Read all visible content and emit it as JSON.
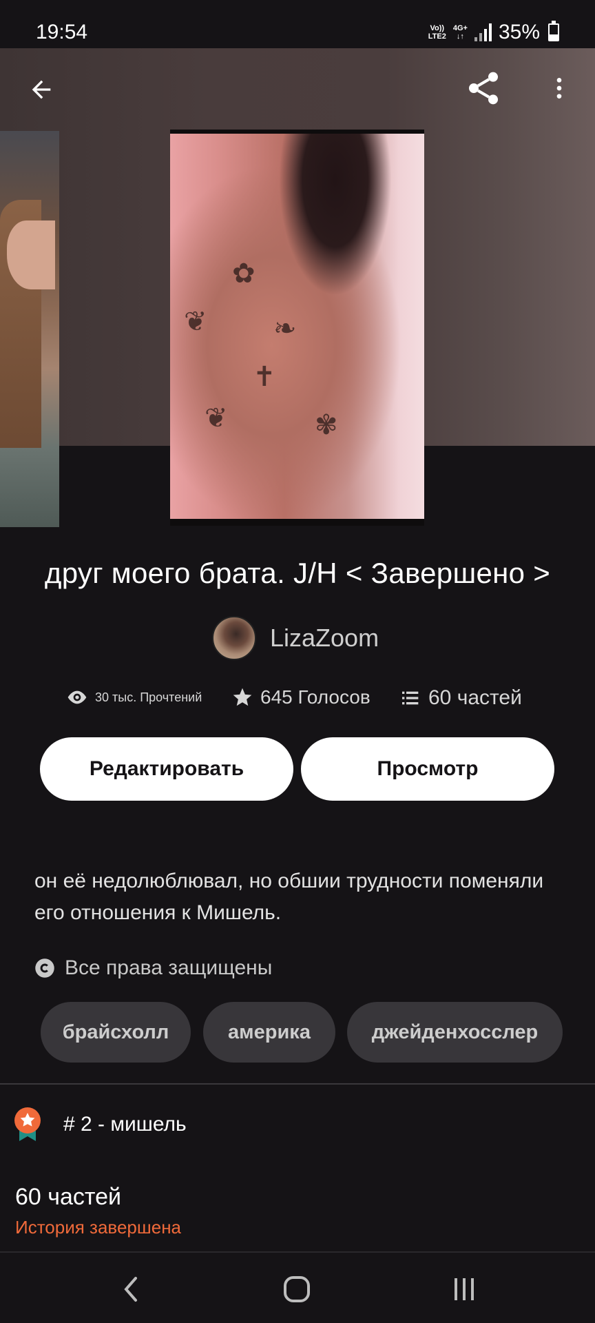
{
  "status_bar": {
    "time": "19:54",
    "network_top": "Vo))",
    "network_bottom": "LTE2",
    "network_type": "4G+",
    "network_arrows": "↓↑",
    "battery": "35%"
  },
  "toolbar": {
    "back_icon": "arrow-left-icon",
    "share_icon": "share-icon",
    "more_icon": "more-vertical-icon"
  },
  "book": {
    "title": "друг моего брата. J/H < Завершено >",
    "author": "LizaZoom",
    "stats": {
      "reads": "30 тыс. Прочтений",
      "votes": "645 Голосов",
      "parts": "60 частей"
    },
    "description": "он её недолюблювал, но обшии трудности поменяли его отношения к Мишель.",
    "copyright": "Все права защищены",
    "tags": [
      "брайсхолл",
      "америка",
      "джейденхосслер"
    ],
    "ranking": "# 2 - мишель",
    "parts_count": "60 частей",
    "status": "История завершена"
  },
  "actions": {
    "edit_label": "Редактировать",
    "view_label": "Просмотр"
  },
  "colors": {
    "background": "#151316",
    "accent_orange": "#f06a3a",
    "button_bg": "#ffffff",
    "tag_bg": "#38363a"
  }
}
